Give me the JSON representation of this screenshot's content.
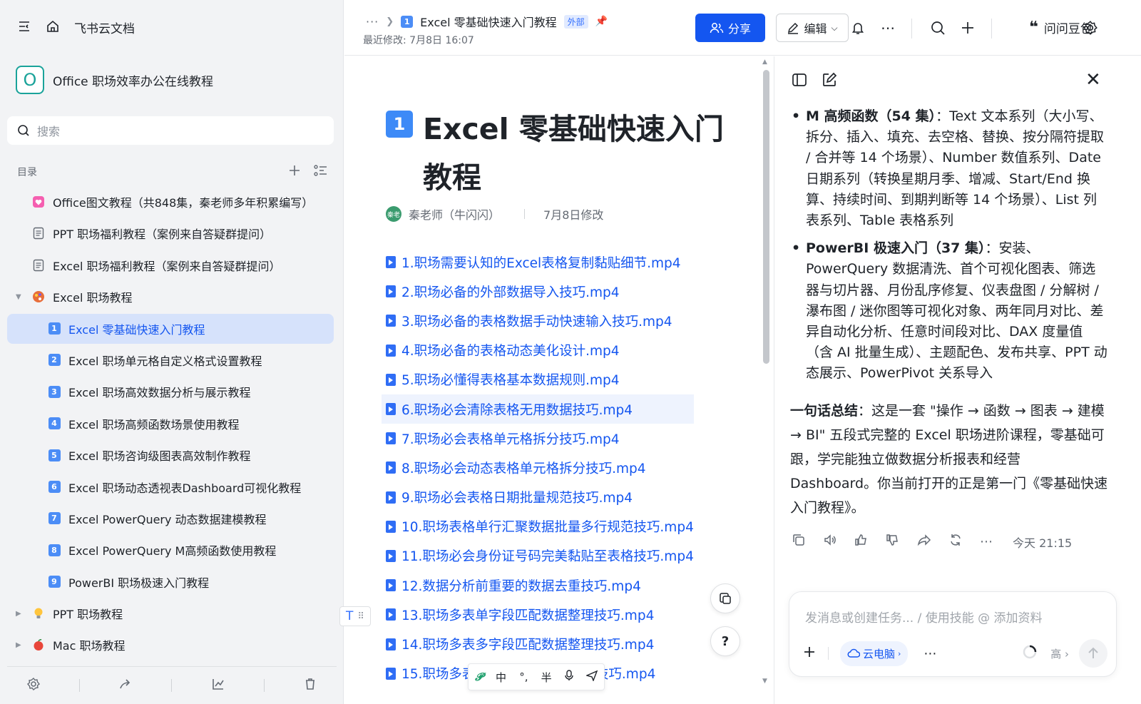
{
  "sidebar": {
    "brand": "飞书云文档",
    "workspace_logo": "O",
    "workspace_name": "Office 职场效率办公在线教程",
    "search_placeholder": "搜索",
    "toc_label": "目录",
    "items": [
      {
        "label": "Office图文教程（共848集，秦老师多年积累编写）",
        "icon": "heart-icon"
      },
      {
        "label": "PPT 职场福利教程（案例来自答疑群提问）",
        "icon": "doc-icon"
      },
      {
        "label": "Excel 职场福利教程（案例来自答疑群提问）",
        "icon": "doc-icon"
      },
      {
        "label": "Excel 职场教程",
        "icon": "palette-icon",
        "expanded": true
      }
    ],
    "sub_items": [
      {
        "num": "1",
        "label": "Excel 零基础快速入门教程",
        "active": true
      },
      {
        "num": "2",
        "label": "Excel 职场单元格自定义格式设置教程"
      },
      {
        "num": "3",
        "label": "Excel 职场高效数据分析与展示教程"
      },
      {
        "num": "4",
        "label": "Excel 职场高频函数场景使用教程"
      },
      {
        "num": "5",
        "label": "Excel 职场咨询级图表高效制作教程"
      },
      {
        "num": "6",
        "label": "Excel 职场动态透视表Dashboard可视化教程"
      },
      {
        "num": "7",
        "label": "Excel PowerQuery 动态数据建模教程"
      },
      {
        "num": "8",
        "label": "Excel PowerQuery M高频函数使用教程"
      },
      {
        "num": "9",
        "label": "PowerBI 职场极速入门教程"
      }
    ],
    "tail_items": [
      {
        "label": "PPT 职场教程",
        "icon": "bulb-icon"
      },
      {
        "label": "Mac 职场教程",
        "icon": "apple-icon"
      }
    ]
  },
  "topbar": {
    "more": "···",
    "title_num": "1",
    "title": "Excel 零基础快速入门教程",
    "tag": "外部",
    "modified": "最近修改: 7月8日 16:07",
    "share_label": "分享",
    "edit_label": "编辑",
    "ai_name": "问问豆包"
  },
  "doc": {
    "title_num": "1",
    "title": "Excel 零基础快速入门教程",
    "author_avatar": "秦老",
    "author": "秦老师（牛闪闪）",
    "modified": "7月8日修改",
    "files": [
      "1.职场需要认知的Excel表格复制黏贴细节.mp4",
      "2.职场必备的外部数据导入技巧.mp4",
      "3.职场必备的表格数据手动快速输入技巧.mp4",
      "4.职场必备的表格动态美化设计.mp4",
      "5.职场必懂得表格基本数据规则.mp4",
      "6.职场必会清除表格无用数据技巧.mp4",
      "7.职场必会表格单元格拆分技巧.mp4",
      "8.职场必会动态表格单元格拆分技巧.mp4",
      "9.职场必会表格日期批量规范技巧.mp4",
      "10.职场表格单行汇聚数据批量多行规范技巧.mp4",
      "11.职场必会身份证号码完美黏贴至表格技巧.mp4",
      "12.数据分析前重要的数据去重技巧.mp4",
      "13.职场多表单字段匹配数据整理技巧.mp4",
      "14.职场多表多字段匹配数据整理技巧.mp4",
      "15.职场多表"
    ],
    "file15_tail": "汇技巧.mp4",
    "highlighted_index": 5,
    "t_handle": "T",
    "ime": [
      "中",
      "°,",
      "半",
      "🎤",
      "✈"
    ]
  },
  "ai_panel": {
    "bullets": [
      {
        "bold": "M 高频函数（54 集）",
        "text": "：Text 文本系列（大小写、拆分、插入、填充、去空格、替换、按分隔符提取 / 合并等 14 个场景）、Number 数值系列、Date 日期系列（转换星期月季、增减、Start/End 换算、持续时间、到期判断等 14 个场景）、List 列表系列、Table 表格系列"
      },
      {
        "bold": "PowerBI 极速入门（37 集）",
        "text": "：安装、PowerQuery 数据清洗、首个可视化图表、筛选器与切片器、月份乱序修复、仪表盘图 / 分解树 / 瀑布图 / 迷你图等可视化对象、两年同月对比、差异自动化分析、任意时间段对比、DAX 度量值（含 AI 批量生成）、主题配色、发布共享、PPT 动态展示、PowerPivot 关系导入"
      }
    ],
    "summary_bold": "一句话总结",
    "summary_text": "：这是一套 \"操作 → 函数 → 图表 → 建模 → BI\" 五段式完整的 Excel 职场进阶课程，零基础可跟，学完能独立做数据分析报表和经营 Dashboard。你当前打开的正是第一门《零基础快速入门教程》。",
    "time": "今天 21:15",
    "composer_placeholder": "发消息或创建任务... / 使用技能 @ 添加资料",
    "cloud_label": "云电脑",
    "level_label": "高"
  },
  "colors": {
    "accent": "#1456f0",
    "sidebar_bg": "#f2f3f5",
    "active_bg": "#d6e2fb",
    "tag_bg": "#e1eaff"
  }
}
